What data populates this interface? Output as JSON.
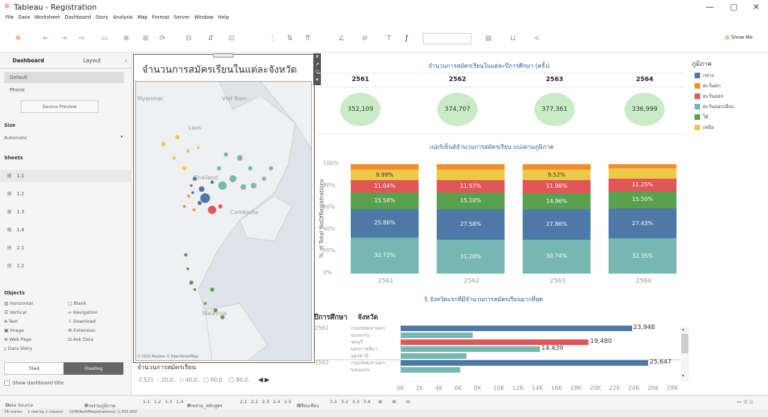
{
  "window": {
    "title": "Tableau - Registration"
  },
  "menu": [
    "File",
    "Data",
    "Worksheet",
    "Dashboard",
    "Story",
    "Analysis",
    "Map",
    "Format",
    "Server",
    "Window",
    "Help"
  ],
  "toolbar": {
    "show_me": "Show Me"
  },
  "left_pane": {
    "tab_dashboard": "Dashboard",
    "tab_layout": "Layout",
    "device_default": "Default",
    "device_phone": "Phone",
    "device_preview": "Device Preview",
    "size_label": "Size",
    "size_value": "Automatic",
    "sheets_label": "Sheets",
    "sheets": [
      "1.1",
      "1.2",
      "1.3",
      "1.4",
      "2.1",
      "2.2"
    ],
    "objects_label": "Objects",
    "objects": [
      "Horizontal",
      "Blank",
      "Vertical",
      "Navigation",
      "Text",
      "Download",
      "Image",
      "Extension",
      "Web Page",
      "Ask Data",
      "Data Story"
    ],
    "tiled": "Tiled",
    "floating": "Floating",
    "show_title": "Show dashboard title"
  },
  "map_panel": {
    "title": "จำนวนการสมัครเรียนในแต่ละจังหวัด",
    "labels": [
      "Myanmar",
      "Viet Nam",
      "Laos",
      "Thailand",
      "Cambodia",
      "Malaysia"
    ],
    "attribution": "© 2022 Mapbox © OpenStreetMap",
    "size_legend_title": "จำนวนการสมัครเรียน",
    "size_legend": [
      "2,521",
      "20,0..",
      "40,0..",
      "60,0..",
      "80,0.."
    ]
  },
  "totals": {
    "title": "จำนวนการสมัครเรียนในแต่ละปีการศึกษา (ครั้ง)",
    "years": [
      "2561",
      "2562",
      "2563",
      "2564"
    ],
    "values": [
      "352,109",
      "374,707",
      "377,361",
      "336,999"
    ]
  },
  "legend": {
    "title": "ภูมิภาค",
    "items": [
      {
        "name": "กลาง",
        "color": "#4e79a7"
      },
      {
        "name": "ตะวันตก",
        "color": "#f28e2b"
      },
      {
        "name": "ตะวันออก",
        "color": "#e15759"
      },
      {
        "name": "ตะวันออกเฉียง..",
        "color": "#76b7b2"
      },
      {
        "name": "ใต้",
        "color": "#59a14f"
      },
      {
        "name": "เหนือ",
        "color": "#edc948"
      }
    ]
  },
  "chart_data": [
    {
      "type": "bar",
      "title": "เปอร์เซ็นต์จำนวนการสมัครเรียน แบ่งตามภูมิภาค",
      "ylabel": "% of Total NoOfRegistrations",
      "ylim": [
        0,
        100
      ],
      "y_ticks": [
        "100%",
        "80%",
        "60%",
        "40%",
        "20%",
        "0%"
      ],
      "categories": [
        "2561",
        "2562",
        "2563",
        "2564"
      ],
      "series": [
        {
          "name": "ตะวันออกเฉียง..",
          "values": [
            32.72,
            31.2,
            30.74,
            32.35
          ],
          "labels": [
            "32.72%",
            "31.20%",
            "30.74%",
            "32.35%"
          ]
        },
        {
          "name": "กลาง",
          "values": [
            25.86,
            27.58,
            27.86,
            27.43
          ],
          "labels": [
            "25.86%",
            "27.58%",
            "27.86%",
            "27.43%"
          ]
        },
        {
          "name": "ใต้",
          "values": [
            15.58,
            15.1,
            14.96,
            15.5
          ],
          "labels": [
            "15.58%",
            "15.10%",
            "14.96%",
            "15.50%"
          ]
        },
        {
          "name": "ตะวันออก",
          "values": [
            11.04,
            11.57,
            11.96,
            11.25
          ],
          "labels": [
            "11.04%",
            "11.57%",
            "11.96%",
            "11.25%"
          ]
        },
        {
          "name": "เหนือ",
          "values": [
            9.99,
            9.5,
            9.52,
            9.4
          ],
          "labels": [
            "9.99%",
            "",
            "9.52%",
            ""
          ]
        },
        {
          "name": "ตะวันตก",
          "values": [
            4.81,
            5.05,
            4.96,
            4.07
          ],
          "labels": [
            "",
            "",
            "",
            ""
          ]
        }
      ]
    },
    {
      "type": "bar",
      "orientation": "horizontal",
      "title": "5 จังหวัดแรกที่มีจำนวนการสมัครเรียนมากที่สุด",
      "header_year": "ปีการศึกษา",
      "header_province": "จังหวัด",
      "xlim": [
        0,
        28000
      ],
      "x_ticks": [
        "0K",
        "2K",
        "4K",
        "6K",
        "8K",
        "10K",
        "12K",
        "14K",
        "16K",
        "18K",
        "20K",
        "22K",
        "24K",
        "26K",
        "28K"
      ],
      "rows": [
        {
          "year": "2561",
          "province": "กรุงเทพมหานคร",
          "value": 23948,
          "label": "23,948",
          "color": "#4e79a7"
        },
        {
          "year": "",
          "province": "ขอนแก่น",
          "value": 7500,
          "label": "",
          "color": "#76b7b2"
        },
        {
          "year": "",
          "province": "ชลบุรี",
          "value": 19480,
          "label": "19,480",
          "color": "#e15759"
        },
        {
          "year": "",
          "province": "นครราชสีมา",
          "value": 14439,
          "label": "14,439",
          "color": "#76b7b2"
        },
        {
          "year": "",
          "province": "อุดรธานี",
          "value": 6800,
          "label": "",
          "color": "#76b7b2"
        },
        {
          "year": "2562",
          "province": "กรุงเทพมหานคร",
          "value": 25647,
          "label": "25,647",
          "color": "#4e79a7"
        },
        {
          "year": "",
          "province": "ขอนแก่น",
          "value": 6200,
          "label": "",
          "color": "#76b7b2"
        }
      ]
    }
  ],
  "bottom_tabs": {
    "data_source": "Data Source",
    "tabs": [
      "ภาพรวมภูมิภาค",
      "1.1",
      "1.2",
      "1.3",
      "1.4",
      "ภาพรวม_หลักสูตร",
      "2.1",
      "2.2",
      "2.3",
      "2.4",
      "2.5",
      "เปรียบเทียบ",
      "3.1",
      "3.2",
      "3.3",
      "3.4"
    ]
  },
  "status": {
    "marks": "76 marks",
    "rows": "1 row by 1 column",
    "sum": "SUM(NoOfRegistrations): 1,432,950"
  }
}
